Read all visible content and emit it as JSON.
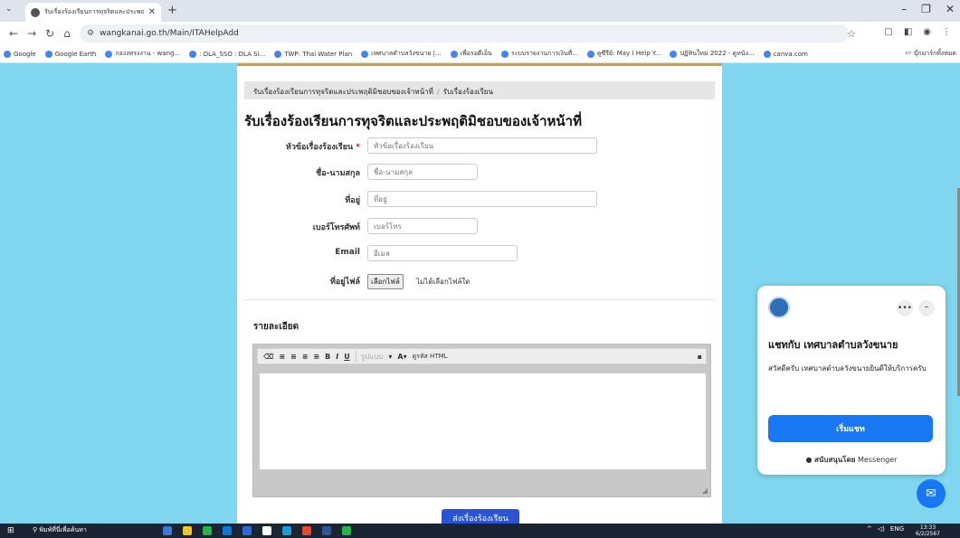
{
  "browser": {
    "tab_title": "รับเรื่องร้องเรียนการทุจริตและประพฤติมิชอบ",
    "url": "wangkanai.go.th/Main/ITAHelpAdd",
    "bookmarks": [
      "Google",
      "Google Earth",
      "กองงทรงงาน - wang...",
      ": DLA_SSO : DLA Si...",
      "TWP: Thai Water Plan",
      "เทศบาลตำบลวังขนาย |...",
      "เพื่อรอดีเอ็น",
      "ระบบรายงานการเงินที่...",
      "ดูซีรีย์: May I Help Y...",
      "ปฏิทินใหม่ 2022 - ดูหนัง...",
      "canva.com"
    ],
    "bookmarks_folder": "บุ๊กมาร์กทั้งหมด"
  },
  "breadcrumb": {
    "parent": "รับเรื่องร้องเรียนการทุจริตและประพฤติมิชอบของเจ้าหน้าที่",
    "current": "รับเรื่องร้องเรียน"
  },
  "form": {
    "heading": "รับเรื่องร้องเรียนการทุจริตและประพฤติมิชอบของเจ้าหน้าที่",
    "subject_label": "หัวข้อเรื่องร้องเรียน",
    "subject_required": "*",
    "subject_placeholder": "หัวข้อเรื่องร้องเรียน",
    "name_label": "ชื่อ-นามสกุล",
    "name_placeholder": "ชื่อ-นามสกุล",
    "address_label": "ที่อยู่",
    "address_placeholder": "ที่อยู่",
    "phone_label": "เบอร์โทรศัพท์",
    "phone_placeholder": "เบอร์โทร",
    "email_label": "Email",
    "email_placeholder": "อีเมล",
    "file_label": "ที่อยู่ไฟล์",
    "file_button": "เลือกไฟล์",
    "file_status": "ไม่ได้เลือกไฟล์ใด",
    "details_heading": "รายละเอียด",
    "editor_font_placeholder": "รูปแบบ",
    "editor_html_label": "ดูรหัส HTML",
    "submit_label": "ส่งเรื่องร้องเรียน"
  },
  "messenger": {
    "title": "แชทกับ เทศบาลตำบลวังขนาย",
    "greeting": "สวัสดีครับ เทศบาลตำบลวังขนายยินดีให้บริการครับ",
    "start_button": "เริ่มแชท",
    "powered_prefix": "สนับสนุนโดย",
    "powered_brand": "Messenger",
    "accent": "#1877f2"
  },
  "taskbar": {
    "search_placeholder": "พิมพ์ที่นี่เพื่อค้นหา",
    "lang": "ENG",
    "time": "13:33",
    "date": "6/2/2567"
  }
}
